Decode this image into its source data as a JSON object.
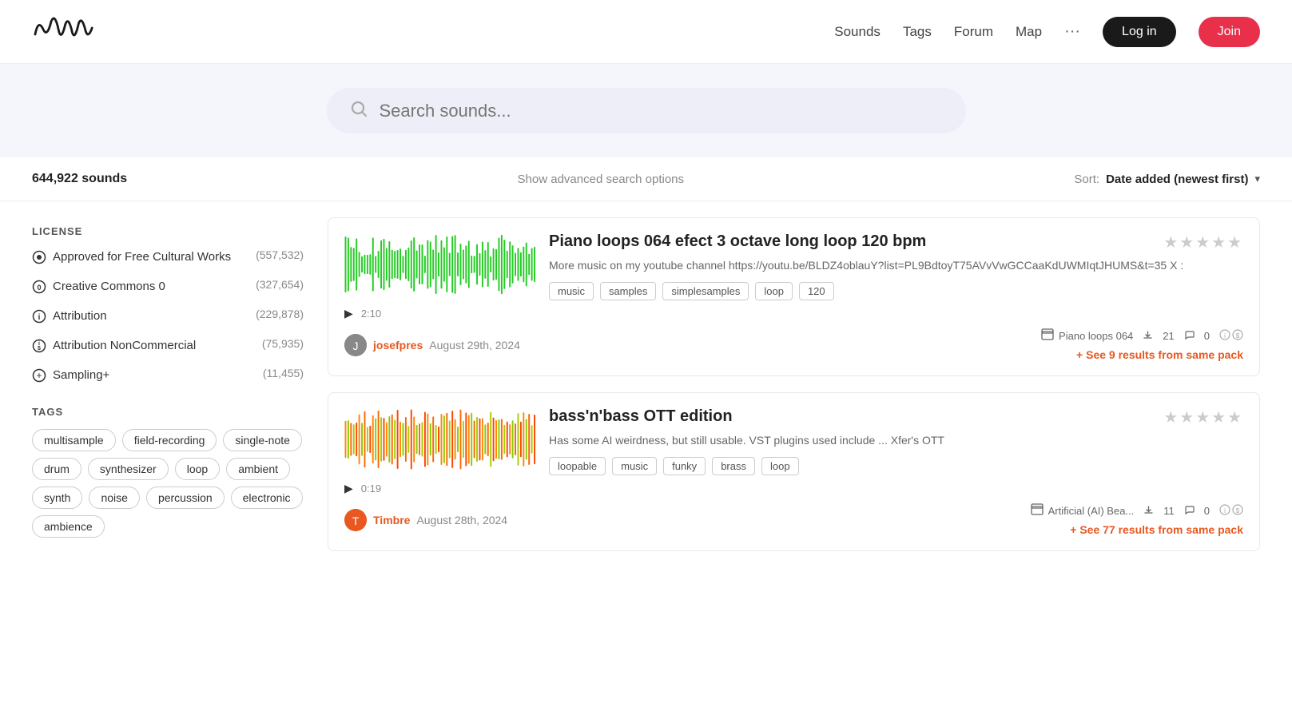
{
  "header": {
    "logo_alt": "Freesound logo",
    "nav": {
      "sounds": "Sounds",
      "tags": "Tags",
      "forum": "Forum",
      "map": "Map",
      "more": "···",
      "login": "Log in",
      "join": "Join"
    }
  },
  "search": {
    "placeholder": "Search sounds..."
  },
  "results": {
    "count": "644,922 sounds",
    "advanced": "Show advanced search options",
    "sort_label": "Sort:",
    "sort_value": "Date added (newest first)"
  },
  "sidebar": {
    "license_title": "LICENSE",
    "licenses": [
      {
        "id": "free-cultural",
        "icon": "⊙",
        "name": "Approved for Free Cultural Works",
        "count": "(557,532)"
      },
      {
        "id": "cc0",
        "icon": "⓪",
        "name": "Creative Commons 0",
        "count": "(327,654)"
      },
      {
        "id": "attribution",
        "icon": "ⓘ",
        "name": "Attribution",
        "count": "(229,878)"
      },
      {
        "id": "attribution-nc",
        "icon": "⊛",
        "name": "Attribution NonCommercial",
        "count": "(75,935)"
      },
      {
        "id": "sampling",
        "icon": "⊕",
        "name": "Sampling+",
        "count": "(11,455)"
      }
    ],
    "tags_title": "TAGS",
    "tags": [
      "multisample",
      "field-recording",
      "single-note",
      "drum",
      "synthesizer",
      "loop",
      "ambient",
      "synth",
      "noise",
      "percussion",
      "electronic",
      "ambience"
    ]
  },
  "sounds": [
    {
      "id": "sound-1",
      "title": "Piano loops 064 efect 3 octave long loop 120 bpm",
      "description": "More music on my youtube channel https://youtu.be/BLDZ4oblauY?list=PL9BdtoyT75AVvVwGCCaaKdUWMIqtJHUMS&t=35 X :",
      "tags": [
        "music",
        "samples",
        "simplesamples",
        "loop",
        "120"
      ],
      "duration": "2:10",
      "username": "josefpres",
      "date": "August 29th, 2024",
      "pack_name": "Piano loops 064",
      "downloads": "21",
      "comments": "0",
      "see_more": "+ See 9 results from same pack",
      "waveform_color": "green"
    },
    {
      "id": "sound-2",
      "title": "bass'n'bass OTT edition",
      "description": "Has some AI weirdness, but still usable. VST plugins used include ... Xfer's OTT",
      "tags": [
        "loopable",
        "music",
        "funky",
        "brass",
        "loop"
      ],
      "duration": "0:19",
      "username": "Timbre",
      "date": "August 28th, 2024",
      "pack_name": "Artificial (AI) Bea...",
      "downloads": "11",
      "comments": "0",
      "see_more": "+ See 77 results from same pack",
      "waveform_color": "orange-green"
    }
  ]
}
